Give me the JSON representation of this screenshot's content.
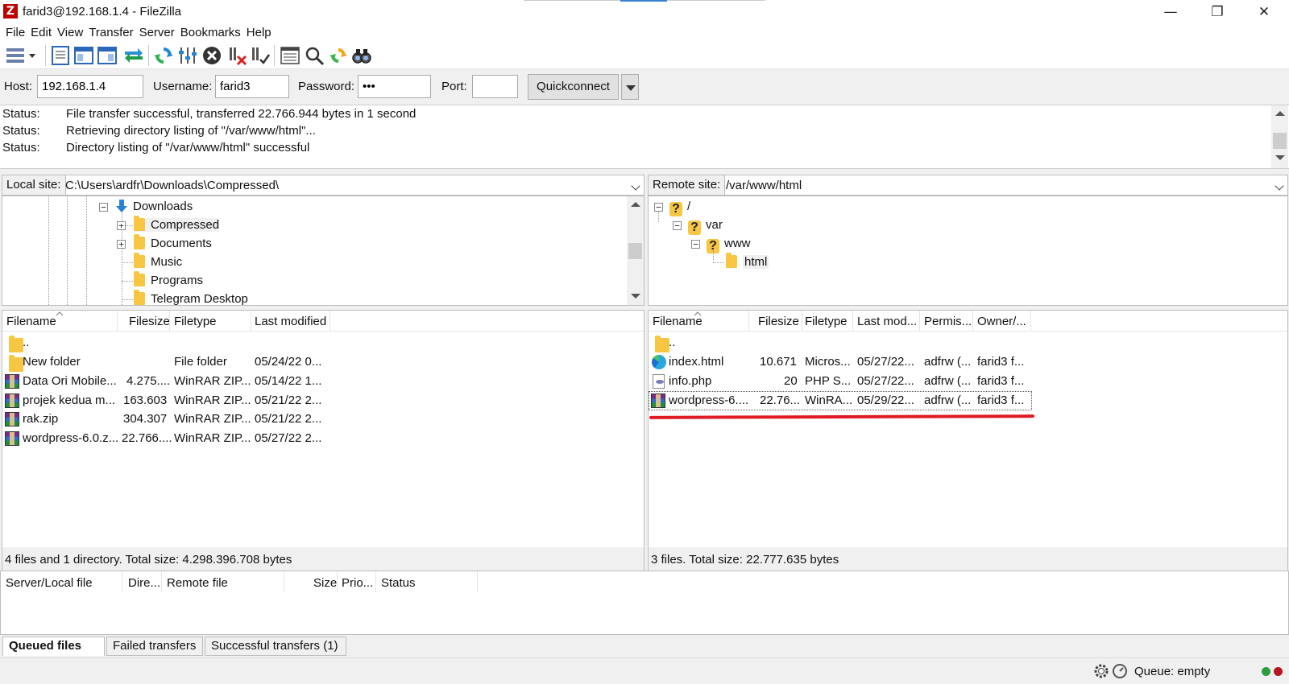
{
  "window": {
    "title": "farid3@192.168.1.4 - FileZilla",
    "app_icon": "Z",
    "minimize": "—",
    "restore": "❐",
    "close": "✕"
  },
  "menu": [
    "File",
    "Edit",
    "View",
    "Transfer",
    "Server",
    "Bookmarks",
    "Help"
  ],
  "quickconnect": {
    "host_label": "Host:",
    "host_value": "192.168.1.4",
    "username_label": "Username:",
    "username_value": "farid3",
    "password_label": "Password:",
    "password_value": "•••",
    "port_label": "Port:",
    "port_value": "",
    "button": "Quickconnect"
  },
  "log": [
    {
      "key": "Status:",
      "msg": "File transfer successful, transferred 22.766.944 bytes in 1 second"
    },
    {
      "key": "Status:",
      "msg": "Retrieving directory listing of \"/var/www/html\"..."
    },
    {
      "key": "Status:",
      "msg": "Directory listing of \"/var/www/html\" successful"
    }
  ],
  "local": {
    "site_label": "Local site:",
    "path": "C:\\Users\\ardfr\\Downloads\\Compressed\\",
    "tree": [
      "Downloads",
      "Compressed",
      "Documents",
      "Music",
      "Programs",
      "Telegram Desktop"
    ],
    "columns": [
      "Filename",
      "Filesize",
      "Filetype",
      "Last modified"
    ],
    "files": [
      {
        "name": "..",
        "size": "",
        "type": "",
        "modified": "",
        "icon": "folder-icon"
      },
      {
        "name": "New folder",
        "size": "",
        "type": "File folder",
        "modified": "05/24/22 0...",
        "icon": "folder-icon"
      },
      {
        "name": "Data Ori Mobile...",
        "size": "4.275....",
        "type": "WinRAR ZIP...",
        "modified": "05/14/22 1...",
        "icon": "winrar-icon"
      },
      {
        "name": "projek kedua m...",
        "size": "163.603",
        "type": "WinRAR ZIP...",
        "modified": "05/21/22 2...",
        "icon": "winrar-icon"
      },
      {
        "name": "rak.zip",
        "size": "304.307",
        "type": "WinRAR ZIP...",
        "modified": "05/21/22 2...",
        "icon": "winrar-icon"
      },
      {
        "name": "wordpress-6.0.z...",
        "size": "22.766....",
        "type": "WinRAR ZIP...",
        "modified": "05/27/22 2...",
        "icon": "winrar-icon"
      }
    ],
    "summary": "4 files and 1 directory. Total size: 4.298.396.708 bytes"
  },
  "remote": {
    "site_label": "Remote site:",
    "path": "/var/www/html",
    "tree": [
      "/",
      "var",
      "www",
      "html"
    ],
    "columns": [
      "Filename",
      "Filesize",
      "Filetype",
      "Last mod...",
      "Permis...",
      "Owner/..."
    ],
    "files": [
      {
        "name": "..",
        "size": "",
        "type": "",
        "modified": "",
        "perms": "",
        "owner": "",
        "icon": "folder-icon"
      },
      {
        "name": "index.html",
        "size": "10.671",
        "type": "Micros...",
        "modified": "05/27/22...",
        "perms": "adfrw (...",
        "owner": "farid3 f...",
        "icon": "edge-icon"
      },
      {
        "name": "info.php",
        "size": "20",
        "type": "PHP S...",
        "modified": "05/27/22...",
        "perms": "adfrw (...",
        "owner": "farid3 f...",
        "icon": "php-file-icon"
      },
      {
        "name": "wordpress-6....",
        "size": "22.76...",
        "type": "WinRA...",
        "modified": "05/29/22...",
        "perms": "adfrw (...",
        "owner": "farid3 f...",
        "icon": "winrar-icon"
      }
    ],
    "summary": "3 files. Total size: 22.777.635 bytes"
  },
  "queue": {
    "columns": [
      "Server/Local file",
      "Dire...",
      "Remote file",
      "Size",
      "Prio...",
      "Status"
    ],
    "tabs": [
      "Queued files",
      "Failed transfers",
      "Successful transfers (1)"
    ],
    "status": "Queue: empty"
  },
  "colors": {
    "annotation_red": "#e01b24",
    "folder_yellow": "#f7c744",
    "close_red": "#bf0000"
  }
}
